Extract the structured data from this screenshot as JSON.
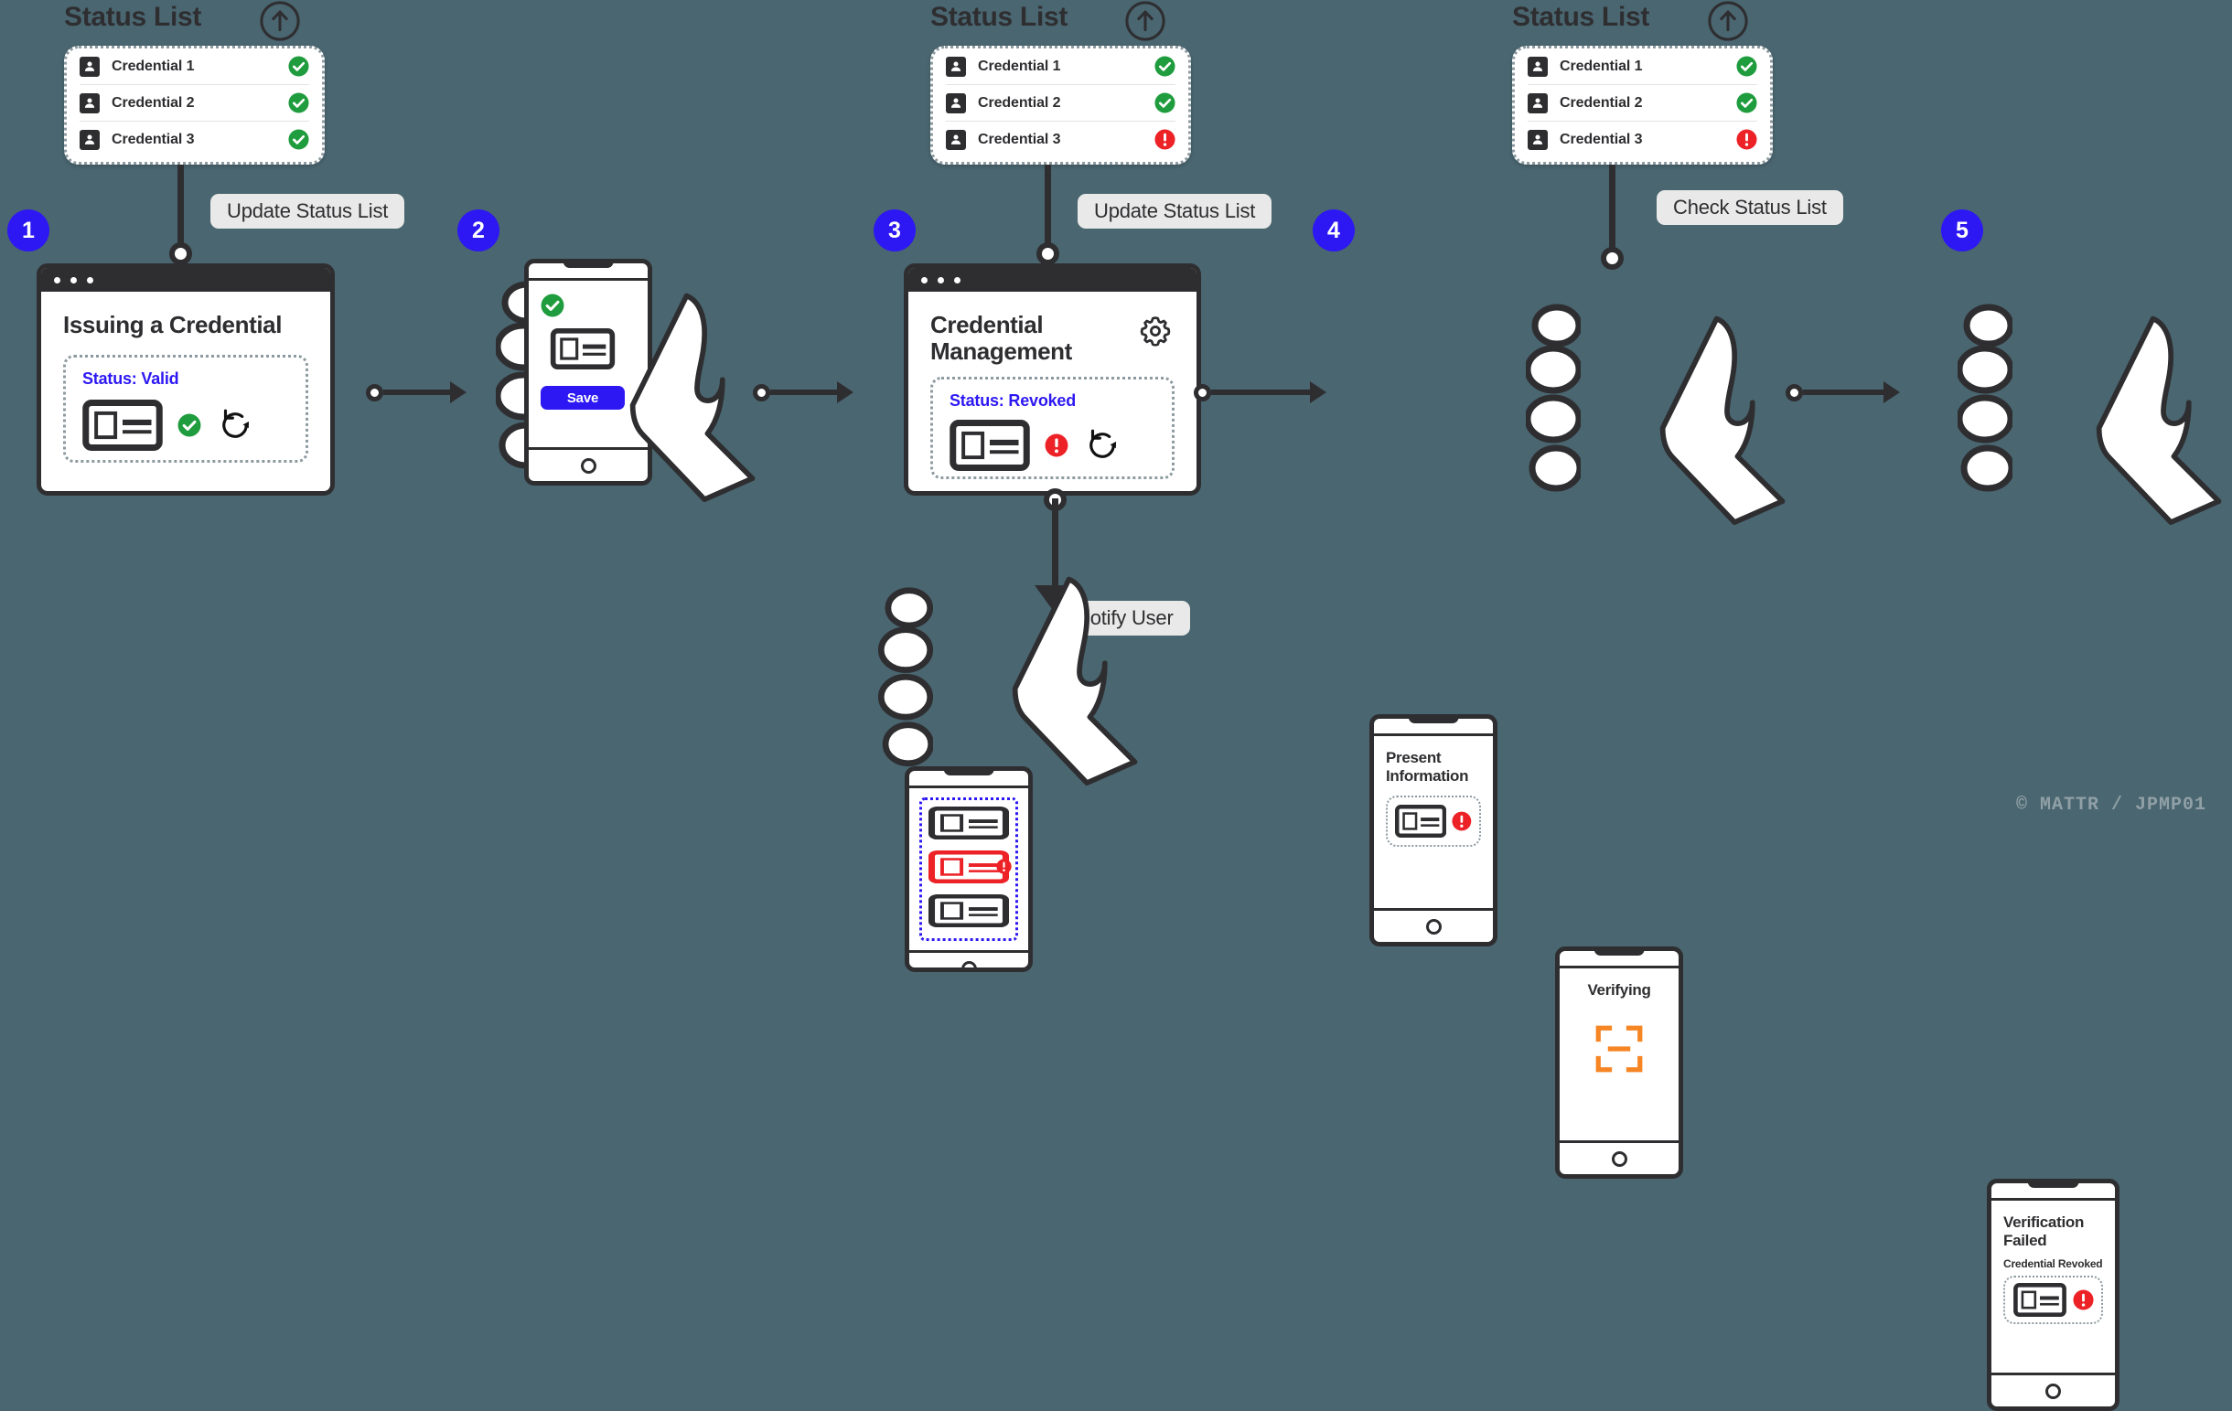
{
  "background_color": "#4a6670",
  "accent_blue": "#2d18f3",
  "ok_green": "#1f9c3d",
  "error_red": "#ec2227",
  "scan_orange": "#f68524",
  "dark": "#2e2e31",
  "status_lists": [
    {
      "title": "Status List",
      "upload_icon": "upload-circle-icon",
      "rows": [
        {
          "icon": "person-badge-icon",
          "label": "Credential 1",
          "status": "valid",
          "status_icon": "check-circle-icon"
        },
        {
          "icon": "person-badge-icon",
          "label": "Credential 2",
          "status": "valid",
          "status_icon": "check-circle-icon"
        },
        {
          "icon": "person-badge-icon",
          "label": "Credential 3",
          "status": "valid",
          "status_icon": "check-circle-icon"
        }
      ]
    },
    {
      "title": "Status List",
      "upload_icon": "upload-circle-icon",
      "rows": [
        {
          "icon": "person-badge-icon",
          "label": "Credential 1",
          "status": "valid",
          "status_icon": "check-circle-icon"
        },
        {
          "icon": "person-badge-icon",
          "label": "Credential 2",
          "status": "valid",
          "status_icon": "check-circle-icon"
        },
        {
          "icon": "person-badge-icon",
          "label": "Credential 3",
          "status": "revoked",
          "status_icon": "alert-circle-icon"
        }
      ]
    },
    {
      "title": "Status List",
      "upload_icon": "upload-circle-icon",
      "rows": [
        {
          "icon": "person-badge-icon",
          "label": "Credential 1",
          "status": "valid",
          "status_icon": "check-circle-icon"
        },
        {
          "icon": "person-badge-icon",
          "label": "Credential 2",
          "status": "valid",
          "status_icon": "check-circle-icon"
        },
        {
          "icon": "person-badge-icon",
          "label": "Credential 3",
          "status": "revoked",
          "status_icon": "alert-circle-icon"
        }
      ]
    }
  ],
  "chips": {
    "update_status_list_1": "Update Status List",
    "update_status_list_2": "Update Status List",
    "check_status_list": "Check Status List",
    "notify_user": "Notify User"
  },
  "steps": [
    {
      "number": "1"
    },
    {
      "number": "2"
    },
    {
      "number": "3"
    },
    {
      "number": "4"
    },
    {
      "number": "5"
    }
  ],
  "step1_window": {
    "title": "Issuing a Credential",
    "status_label": "Status: Valid",
    "card_icon": "credential-card-icon",
    "status_icon": "check-circle-icon",
    "refresh_icon": "refresh-icon"
  },
  "step2_phone": {
    "status_icon": "check-circle-icon",
    "card_icon": "credential-card-icon",
    "save_label": "Save",
    "home_icon": "home-button-icon"
  },
  "step3_window": {
    "title": "Credential Management",
    "settings_icon": "gear-icon",
    "status_label": "Status: Revoked",
    "card_icon": "credential-card-icon",
    "status_icon": "alert-circle-icon",
    "refresh_icon": "refresh-icon"
  },
  "notify_phone": {
    "items": [
      {
        "icon": "credential-card-icon",
        "state": "normal"
      },
      {
        "icon": "credential-card-icon",
        "state": "revoked",
        "status_icon": "alert-circle-icon"
      },
      {
        "icon": "credential-card-icon",
        "state": "normal"
      }
    ],
    "home_icon": "home-button-icon"
  },
  "step4_present_phone": {
    "title": "Present Information",
    "card_icon": "credential-card-icon",
    "status_icon": "alert-circle-icon",
    "home_icon": "home-button-icon"
  },
  "step4_verifying_phone": {
    "title": "Verifying",
    "scan_icon": "scan-frame-icon",
    "home_icon": "home-button-icon"
  },
  "step5_phone": {
    "title": "Verification Failed",
    "subtitle": "Credential Revoked",
    "card_icon": "credential-card-icon",
    "status_icon": "alert-circle-icon",
    "home_icon": "home-button-icon"
  },
  "footer": {
    "text": "© MATTR / JPMP01"
  }
}
